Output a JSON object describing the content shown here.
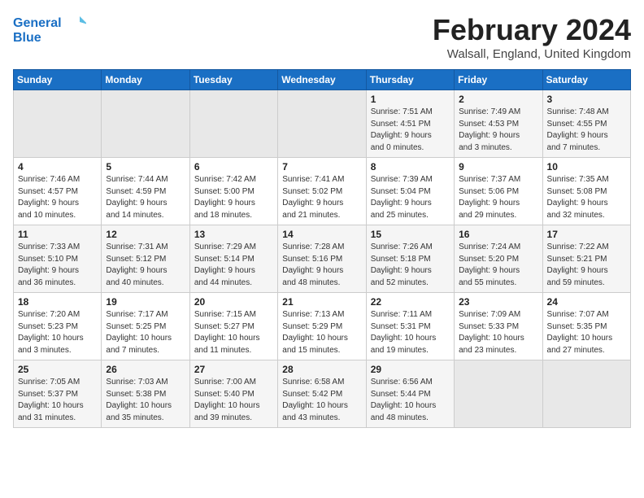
{
  "logo": {
    "line1": "General",
    "line2": "Blue"
  },
  "title": {
    "month_year": "February 2024",
    "location": "Walsall, England, United Kingdom"
  },
  "days_of_week": [
    "Sunday",
    "Monday",
    "Tuesday",
    "Wednesday",
    "Thursday",
    "Friday",
    "Saturday"
  ],
  "weeks": [
    [
      {
        "day": null,
        "info": null
      },
      {
        "day": null,
        "info": null
      },
      {
        "day": null,
        "info": null
      },
      {
        "day": null,
        "info": null
      },
      {
        "day": "1",
        "info": "Sunrise: 7:51 AM\nSunset: 4:51 PM\nDaylight: 9 hours\nand 0 minutes."
      },
      {
        "day": "2",
        "info": "Sunrise: 7:49 AM\nSunset: 4:53 PM\nDaylight: 9 hours\nand 3 minutes."
      },
      {
        "day": "3",
        "info": "Sunrise: 7:48 AM\nSunset: 4:55 PM\nDaylight: 9 hours\nand 7 minutes."
      }
    ],
    [
      {
        "day": "4",
        "info": "Sunrise: 7:46 AM\nSunset: 4:57 PM\nDaylight: 9 hours\nand 10 minutes."
      },
      {
        "day": "5",
        "info": "Sunrise: 7:44 AM\nSunset: 4:59 PM\nDaylight: 9 hours\nand 14 minutes."
      },
      {
        "day": "6",
        "info": "Sunrise: 7:42 AM\nSunset: 5:00 PM\nDaylight: 9 hours\nand 18 minutes."
      },
      {
        "day": "7",
        "info": "Sunrise: 7:41 AM\nSunset: 5:02 PM\nDaylight: 9 hours\nand 21 minutes."
      },
      {
        "day": "8",
        "info": "Sunrise: 7:39 AM\nSunset: 5:04 PM\nDaylight: 9 hours\nand 25 minutes."
      },
      {
        "day": "9",
        "info": "Sunrise: 7:37 AM\nSunset: 5:06 PM\nDaylight: 9 hours\nand 29 minutes."
      },
      {
        "day": "10",
        "info": "Sunrise: 7:35 AM\nSunset: 5:08 PM\nDaylight: 9 hours\nand 32 minutes."
      }
    ],
    [
      {
        "day": "11",
        "info": "Sunrise: 7:33 AM\nSunset: 5:10 PM\nDaylight: 9 hours\nand 36 minutes."
      },
      {
        "day": "12",
        "info": "Sunrise: 7:31 AM\nSunset: 5:12 PM\nDaylight: 9 hours\nand 40 minutes."
      },
      {
        "day": "13",
        "info": "Sunrise: 7:29 AM\nSunset: 5:14 PM\nDaylight: 9 hours\nand 44 minutes."
      },
      {
        "day": "14",
        "info": "Sunrise: 7:28 AM\nSunset: 5:16 PM\nDaylight: 9 hours\nand 48 minutes."
      },
      {
        "day": "15",
        "info": "Sunrise: 7:26 AM\nSunset: 5:18 PM\nDaylight: 9 hours\nand 52 minutes."
      },
      {
        "day": "16",
        "info": "Sunrise: 7:24 AM\nSunset: 5:20 PM\nDaylight: 9 hours\nand 55 minutes."
      },
      {
        "day": "17",
        "info": "Sunrise: 7:22 AM\nSunset: 5:21 PM\nDaylight: 9 hours\nand 59 minutes."
      }
    ],
    [
      {
        "day": "18",
        "info": "Sunrise: 7:20 AM\nSunset: 5:23 PM\nDaylight: 10 hours\nand 3 minutes."
      },
      {
        "day": "19",
        "info": "Sunrise: 7:17 AM\nSunset: 5:25 PM\nDaylight: 10 hours\nand 7 minutes."
      },
      {
        "day": "20",
        "info": "Sunrise: 7:15 AM\nSunset: 5:27 PM\nDaylight: 10 hours\nand 11 minutes."
      },
      {
        "day": "21",
        "info": "Sunrise: 7:13 AM\nSunset: 5:29 PM\nDaylight: 10 hours\nand 15 minutes."
      },
      {
        "day": "22",
        "info": "Sunrise: 7:11 AM\nSunset: 5:31 PM\nDaylight: 10 hours\nand 19 minutes."
      },
      {
        "day": "23",
        "info": "Sunrise: 7:09 AM\nSunset: 5:33 PM\nDaylight: 10 hours\nand 23 minutes."
      },
      {
        "day": "24",
        "info": "Sunrise: 7:07 AM\nSunset: 5:35 PM\nDaylight: 10 hours\nand 27 minutes."
      }
    ],
    [
      {
        "day": "25",
        "info": "Sunrise: 7:05 AM\nSunset: 5:37 PM\nDaylight: 10 hours\nand 31 minutes."
      },
      {
        "day": "26",
        "info": "Sunrise: 7:03 AM\nSunset: 5:38 PM\nDaylight: 10 hours\nand 35 minutes."
      },
      {
        "day": "27",
        "info": "Sunrise: 7:00 AM\nSunset: 5:40 PM\nDaylight: 10 hours\nand 39 minutes."
      },
      {
        "day": "28",
        "info": "Sunrise: 6:58 AM\nSunset: 5:42 PM\nDaylight: 10 hours\nand 43 minutes."
      },
      {
        "day": "29",
        "info": "Sunrise: 6:56 AM\nSunset: 5:44 PM\nDaylight: 10 hours\nand 48 minutes."
      },
      {
        "day": null,
        "info": null
      },
      {
        "day": null,
        "info": null
      }
    ]
  ]
}
